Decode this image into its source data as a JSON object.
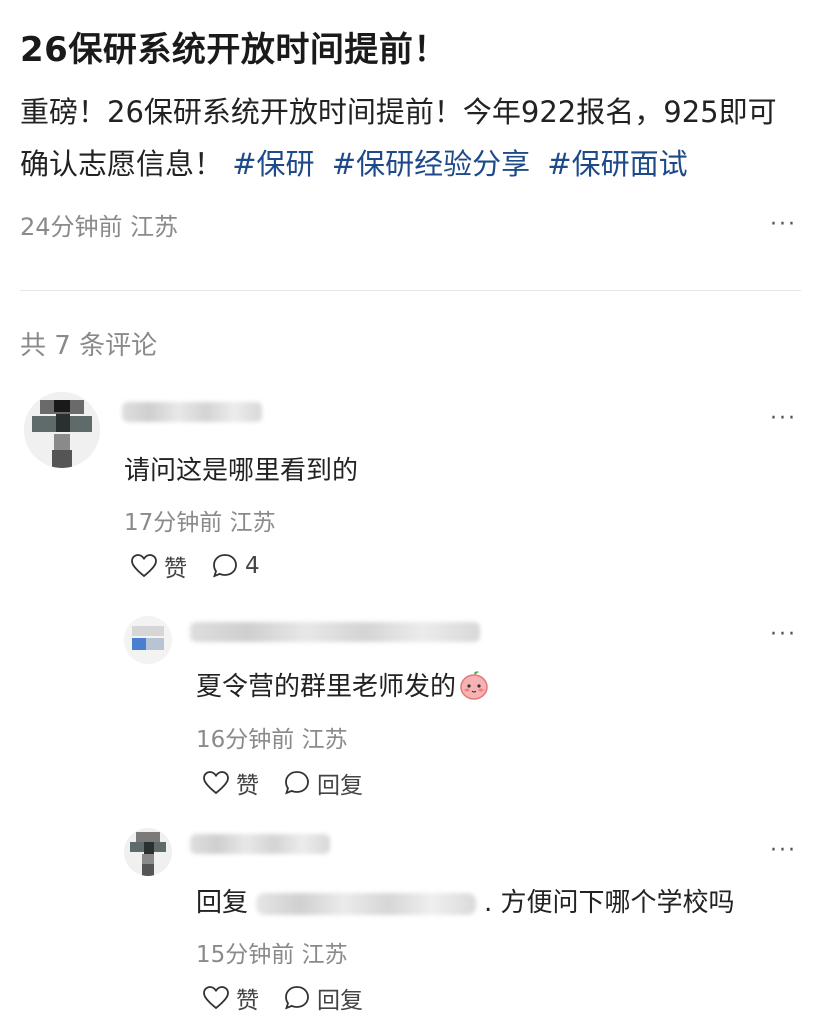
{
  "post": {
    "title": "26保研系统开放时间提前！",
    "body_text": "重磅！26保研系统开放时间提前！今年922报名，925即可确认志愿信息！",
    "hashtags": [
      "#保研",
      "#保研经验分享",
      "#保研面试"
    ],
    "meta": "24分钟前 江苏",
    "more_icon": "···"
  },
  "comments_header": "共 7 条评论",
  "comments": [
    {
      "text": "请问这是哪里看到的",
      "meta": "17分钟前 江苏",
      "like_label": "赞",
      "reply_label": "4"
    },
    {
      "text": "夏令营的群里老师发的",
      "meta": "16分钟前 江苏",
      "like_label": "赞",
      "reply_label": "回复"
    },
    {
      "text_prefix": "回复",
      "text_suffix": ". 方便问下哪个学校吗",
      "meta": "15分钟前 江苏",
      "like_label": "赞",
      "reply_label": "回复"
    }
  ],
  "icons": {
    "more": "more-icon",
    "like": "heart-outline-icon",
    "reply": "comment-bubble-icon",
    "emoji": "peach-emoji"
  },
  "colors": {
    "hashtag": "#1e4a8a",
    "meta": "#8a8a8a",
    "text": "#222222"
  }
}
